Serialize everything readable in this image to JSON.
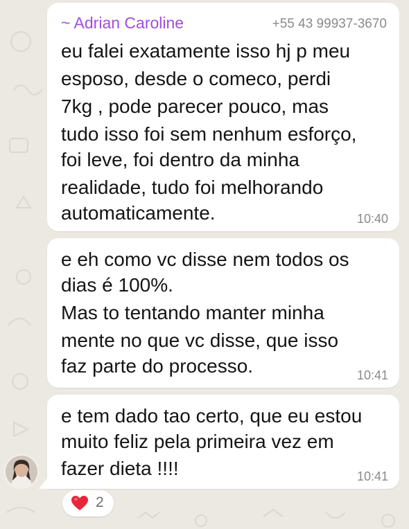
{
  "colors": {
    "sender_name": "#a14de0",
    "bubble": "#ffffff",
    "chat_background": "#ece8e2",
    "timestamp": "#8a8a8a",
    "reaction_heart": "#e8263a"
  },
  "messages": [
    {
      "sender": "~ Adrian Caroline",
      "phone": "+55 43 99937-3670",
      "lines": [
        "eu falei exatamente isso hj p meu",
        "esposo, desde o comeco, perdi",
        "7kg , pode parecer pouco, mas",
        "tudo isso foi sem nenhum esforço,",
        "foi leve, foi dentro da minha",
        "realidade, tudo foi melhorando",
        "automaticamente."
      ],
      "time": "10:40"
    },
    {
      "lines": [
        "e eh como vc disse nem todos os",
        "dias é 100%.",
        "Mas to tentando manter minha",
        "mente no que vc disse, que isso",
        "faz parte do processo."
      ],
      "time": "10:41"
    },
    {
      "lines": [
        "e tem dado tao certo, que eu estou",
        "muito feliz pela primeira vez em",
        "fazer dieta !!!!"
      ],
      "time": "10:41"
    }
  ],
  "reaction": {
    "icon": "heart-icon",
    "count": "2"
  }
}
